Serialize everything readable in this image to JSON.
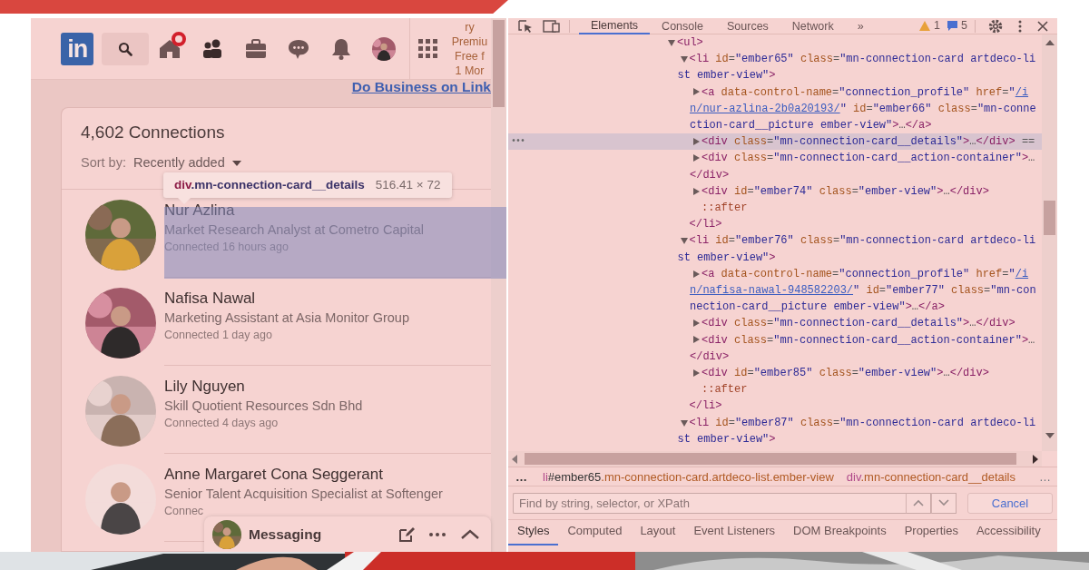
{
  "linkedin": {
    "header": {
      "logo": "in",
      "nav_icons": [
        {
          "kind": "home",
          "badge": true
        },
        {
          "kind": "people",
          "badge": false
        },
        {
          "kind": "briefcase",
          "badge": false
        },
        {
          "kind": "chat",
          "badge": false
        },
        {
          "kind": "bell",
          "badge": false
        },
        {
          "kind": "avatar",
          "badge": false
        }
      ],
      "premium_lines": [
        "ry",
        "Premiu",
        "Free f",
        "1 Mor"
      ]
    },
    "promo_link": "Do Business on Link",
    "connections": {
      "title": "4,602 Connections",
      "sort_label": "Sort by:",
      "sort_value": "Recently added",
      "items": [
        {
          "name": "Nur Azlina",
          "headline": "Market Research Analyst at Cometro Capital",
          "connected": "Connected 16 hours ago",
          "highlighted": true
        },
        {
          "name": "Nafisa Nawal",
          "headline": "Marketing Assistant at Asia Monitor Group",
          "connected": "Connected 1 day ago",
          "highlighted": false
        },
        {
          "name": "Lily Nguyen",
          "headline": "Skill Quotient Resources Sdn Bhd",
          "connected": "Connected 4 days ago",
          "highlighted": false
        },
        {
          "name": "Anne Margaret Cona Seggerant",
          "headline": "Senior Talent Acquisition Specialist at Softenger",
          "connected": "Connec",
          "highlighted": false
        }
      ]
    },
    "messaging": {
      "label": "Messaging"
    }
  },
  "inspect_tooltip": {
    "tag": "div",
    "classes": ".mn-connection-card__details",
    "size": "516.41 × 72"
  },
  "devtools": {
    "tabs": [
      {
        "label": "Elements",
        "selected": true
      },
      {
        "label": "Console",
        "selected": false
      },
      {
        "label": "Sources",
        "selected": false
      },
      {
        "label": "Network",
        "selected": false
      }
    ],
    "overflow": "»",
    "warnings": "1",
    "messages": "5",
    "tree": [
      {
        "kind": "element",
        "text": "<ul>",
        "expanded": true,
        "selected": false,
        "children": [
          {
            "kind": "element",
            "text": "<li id=\"ember65\" class=\"mn-connection-card artdeco-list ember-view\">",
            "expanded": true,
            "selected": false,
            "closing": "</li>",
            "children": [
              {
                "kind": "element",
                "text": "<a data-control-name=\"connection_profile\" href=\"/in/nur-azlina-2b0a20193/\" id=\"ember66\" class=\"mn-connection-card__picture ember-view\">…</a>",
                "expanded": false,
                "selected": false
              },
              {
                "kind": "element",
                "text": "<div class=\"mn-connection-card__details\">…</div> ==",
                "expanded": false,
                "selected": true,
                "gutter": "•••"
              },
              {
                "kind": "element",
                "text": "<div class=\"mn-connection-card__action-container\">…",
                "expanded": false,
                "selected": false,
                "closing": "</div>"
              },
              {
                "kind": "element",
                "text": "<div id=\"ember74\" class=\"ember-view\">…</div>",
                "expanded": false,
                "selected": false
              },
              {
                "kind": "pseudo",
                "text": "::after"
              }
            ]
          },
          {
            "kind": "element",
            "text": "<li id=\"ember76\" class=\"mn-connection-card artdeco-list ember-view\">",
            "expanded": true,
            "selected": false,
            "closing": "</li>",
            "children": [
              {
                "kind": "element",
                "text": "<a data-control-name=\"connection_profile\" href=\"/in/nafisa-nawal-948582203/\" id=\"ember77\" class=\"mn-connection-card__picture ember-view\">…</a>",
                "expanded": false,
                "selected": false
              },
              {
                "kind": "element",
                "text": "<div class=\"mn-connection-card__details\">…</div>",
                "expanded": false,
                "selected": false
              },
              {
                "kind": "element",
                "text": "<div class=\"mn-connection-card__action-container\">…",
                "expanded": false,
                "selected": false,
                "closing": "</div>"
              },
              {
                "kind": "element",
                "text": "<div id=\"ember85\" class=\"ember-view\">…</div>",
                "expanded": false,
                "selected": false
              },
              {
                "kind": "pseudo",
                "text": "::after"
              }
            ]
          },
          {
            "kind": "element",
            "text": "<li id=\"ember87\" class=\"mn-connection-card artdeco-list ember-view\">",
            "expanded": true,
            "selected": false
          }
        ]
      }
    ],
    "breadcrumbs": [
      "…",
      "li#ember65.mn-connection-card.artdeco-list.ember-view",
      "div.mn-connection-card__details",
      "…"
    ],
    "search": {
      "placeholder": "Find by string, selector, or XPath",
      "cancel": "Cancel"
    },
    "pane_tabs": [
      {
        "label": "Styles",
        "selected": true
      },
      {
        "label": "Computed",
        "selected": false
      },
      {
        "label": "Layout",
        "selected": false
      },
      {
        "label": "Event Listeners",
        "selected": false
      },
      {
        "label": "DOM Breakpoints",
        "selected": false
      },
      {
        "label": "Properties",
        "selected": false
      },
      {
        "label": "Accessibility",
        "selected": false
      }
    ]
  }
}
